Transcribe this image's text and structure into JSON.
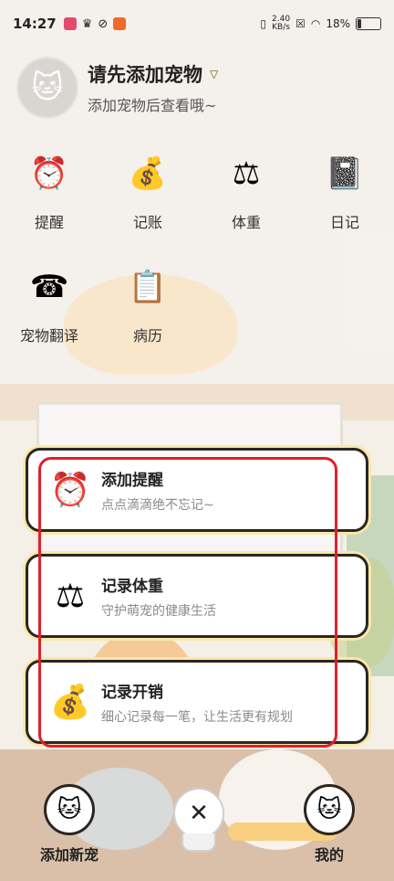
{
  "status_bar": {
    "time": "14:27",
    "net_speed_value": "2.40",
    "net_speed_unit": "KB/s",
    "battery": "18%"
  },
  "header": {
    "title": "请先添加宠物",
    "subtitle": "添加宠物后查看哦~"
  },
  "grid": [
    {
      "label": "提醒",
      "icon": "alarm-clock-icon"
    },
    {
      "label": "记账",
      "icon": "money-bag-icon"
    },
    {
      "label": "体重",
      "icon": "scale-icon"
    },
    {
      "label": "日记",
      "icon": "diary-icon"
    },
    {
      "label": "宠物翻译",
      "icon": "telephone-icon"
    },
    {
      "label": "病历",
      "icon": "clipboard-icon"
    }
  ],
  "popup": [
    {
      "title": "添加提醒",
      "subtitle": "点点滴滴绝不忘记~",
      "icon": "alarm-clock-icon"
    },
    {
      "title": "记录体重",
      "subtitle": "守护萌宠的健康生活",
      "icon": "scale-icon"
    },
    {
      "title": "记录开销",
      "subtitle": "细心记录每一笔，让生活更有规划",
      "icon": "money-bag-icon"
    }
  ],
  "bottom_nav": {
    "add_new_pet": "添加新宠",
    "mine": "我的",
    "close": "✕"
  },
  "colors": {
    "highlight_frame": "#e0202a",
    "card_glow": "#fbe7a9"
  }
}
